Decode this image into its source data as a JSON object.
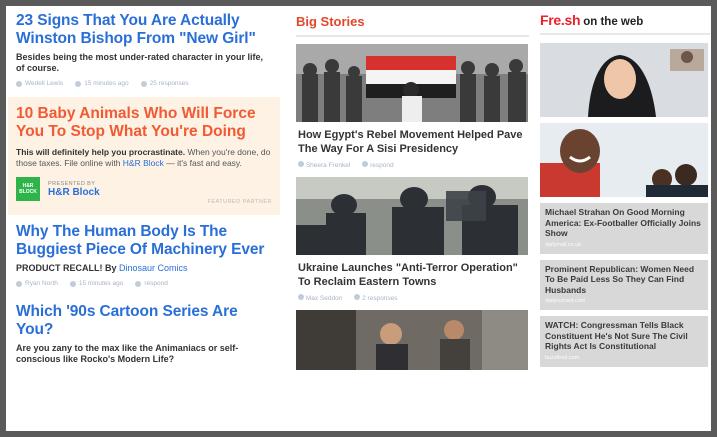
{
  "left_column": {
    "story1": {
      "title": "23 Signs That You Are Actually Winston Bishop From \"New Girl\"",
      "desc": "Besides being the most under-rated character in your life, of course.",
      "author": "Wedell Lewis",
      "time": "15 minutes ago",
      "responses": "25 responses"
    },
    "sponsored": {
      "title": "10 Baby Animals Who Will Force You To Stop What You're Doing",
      "desc_bold": "This will definitely help you procrastinate.",
      "desc_normal_pre": "When you're done, do those taxes. File online with",
      "desc_link": "H&R Block",
      "desc_normal_post": "— it's fast and easy.",
      "presented_by": "PRESENTED BY",
      "sponsor_name": "H&R Block",
      "logo_text": "H&R BLOCK",
      "featured": "FEATURED PARTNER"
    },
    "story2": {
      "title": "Why The Human Body Is The Buggiest Piece Of Machinery Ever",
      "desc_pre": "PRODUCT RECALL! By",
      "desc_link": "Dinosaur Comics",
      "author": "Ryan North",
      "time": "15 minutes ago",
      "responses": "respond"
    },
    "story3": {
      "title": "Which '90s Cartoon Series Are You?",
      "desc": "Are you zany to the max like the Animaniacs or self-conscious like Rocko's Modern Life?"
    }
  },
  "middle_column": {
    "heading": "Big Stories",
    "stories": [
      {
        "title": "How Egypt's Rebel Movement Helped Pave The Way For A Sisi Presidency",
        "author": "Sheera Frenkel",
        "responses": "respond"
      },
      {
        "title": "Ukraine Launches \"Anti-Terror Operation\" To Reclaim Eastern Towns",
        "author": "Max Seddon",
        "responses": "2 responses"
      }
    ]
  },
  "right_column": {
    "heading_brand": "Fre.sh",
    "heading_rest": "on the web",
    "cards": [
      {
        "title": "Michael Strahan On Good Morning America: Ex-Footballer Officially Joins Show",
        "source": "dailymail.co.uk"
      },
      {
        "title": "Prominent Republican: Women Need To Be Paid Less So They Can Find Husbands",
        "source": "dailycurrant.com"
      },
      {
        "title": "WATCH: Congressman Tells Black Constituent He's Not Sure The Civil Rights Act Is Constitutional",
        "source": "buzzfeed.com"
      }
    ]
  },
  "colors": {
    "link_blue": "#2a6fd8",
    "sponsored_red": "#f25a34",
    "big_stories_red": "#e2472b",
    "sponsored_bg": "#fdf2e3",
    "fresh_red": "#e8232b",
    "card_bg": "#d8d8d8"
  }
}
